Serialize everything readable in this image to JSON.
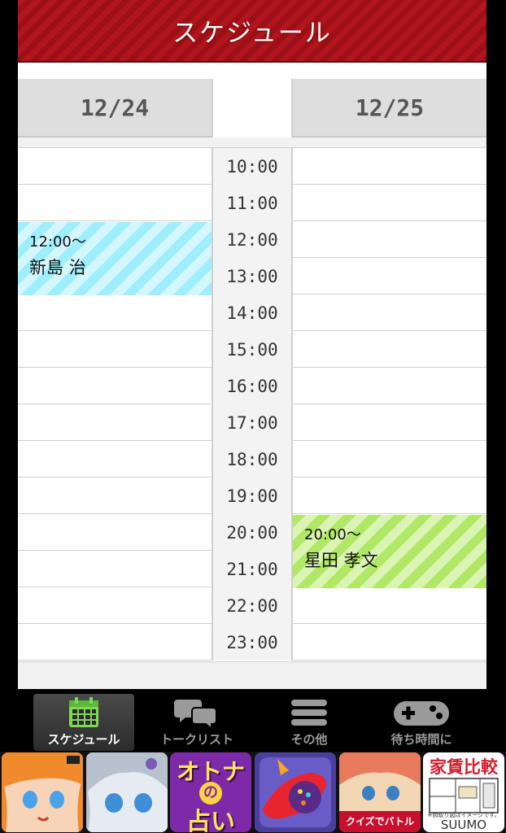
{
  "header": {
    "title": "スケジュール"
  },
  "dates": {
    "left": "12/24",
    "right": "12/25"
  },
  "times": [
    "10:00",
    "11:00",
    "12:00",
    "13:00",
    "14:00",
    "15:00",
    "16:00",
    "17:00",
    "18:00",
    "19:00",
    "20:00",
    "21:00",
    "22:00",
    "23:00"
  ],
  "events": {
    "left": {
      "time": "12:00～",
      "name": "新島 治",
      "color": "#9eeefc"
    },
    "right": {
      "time": "20:00～",
      "name": "星田 孝文",
      "color": "#b0e866"
    }
  },
  "tabs": [
    {
      "label": "スケジュール",
      "icon": "calendar-icon",
      "active": true,
      "color": "#7ed957"
    },
    {
      "label": "トークリスト",
      "icon": "chat-icon",
      "active": false
    },
    {
      "label": "その他",
      "icon": "menu-icon",
      "active": false
    },
    {
      "label": "待ち時間に",
      "icon": "gamepad-icon",
      "active": false
    }
  ],
  "ads": [
    {
      "icon": "anime-girl-orange-app-icon"
    },
    {
      "icon": "anime-girl-silver-app-icon"
    },
    {
      "label": [
        "オトナ",
        "の",
        "占い"
      ]
    },
    {
      "icon": "candy-app-icon"
    },
    {
      "label": "クイズでバトル"
    },
    {
      "title": "家賃比較",
      "label": "SUUMO",
      "note": "※間取り図はイメージです。"
    }
  ]
}
